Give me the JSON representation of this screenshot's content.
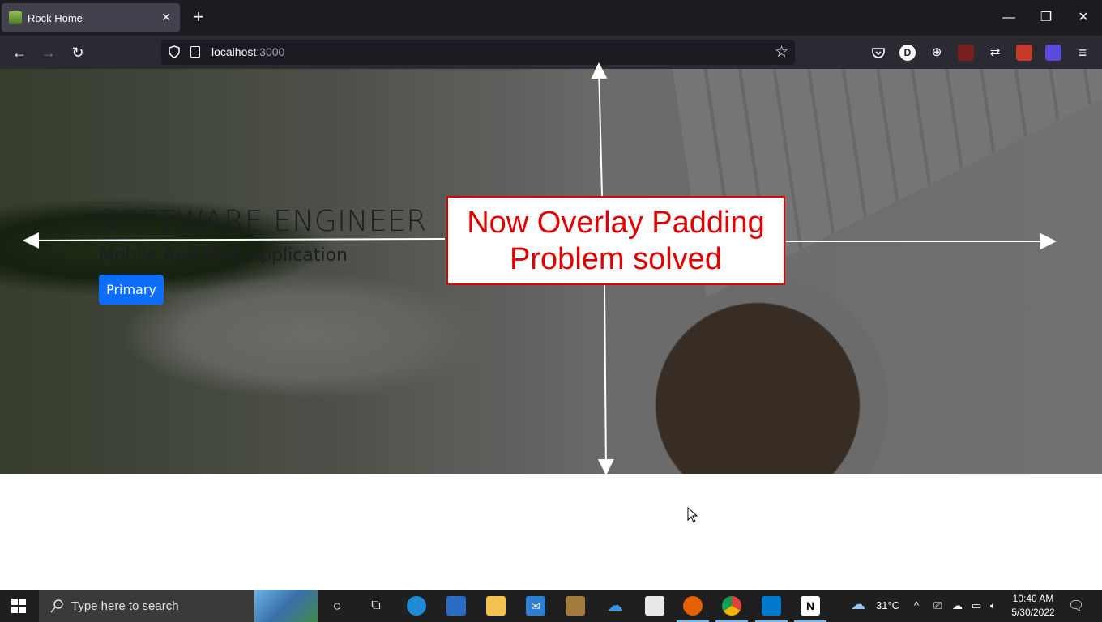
{
  "browser": {
    "tab_title": "Rock Home",
    "url_host": "localhost",
    "url_port": ":3000",
    "icons": [
      "back-icon",
      "forward-icon",
      "reload-icon",
      "shield-icon",
      "bookmark-star-icon",
      "pocket-icon",
      "menu-icon"
    ]
  },
  "hero": {
    "title": "SOFTWARE ENGINEER",
    "subtitle": "Mobile And Web Application",
    "button_label": "Primary"
  },
  "annotation": {
    "line1": "Now Overlay Padding",
    "line2": "Problem solved",
    "color": "#e00000"
  },
  "taskbar": {
    "search_placeholder": "Type here to search",
    "weather": "31°C",
    "time": "10:40 AM",
    "date": "5/30/2022"
  },
  "colors": {
    "primary_button": "#0d6efd",
    "tabbar": "#1c1b22",
    "toolbar": "#2b2a33"
  }
}
